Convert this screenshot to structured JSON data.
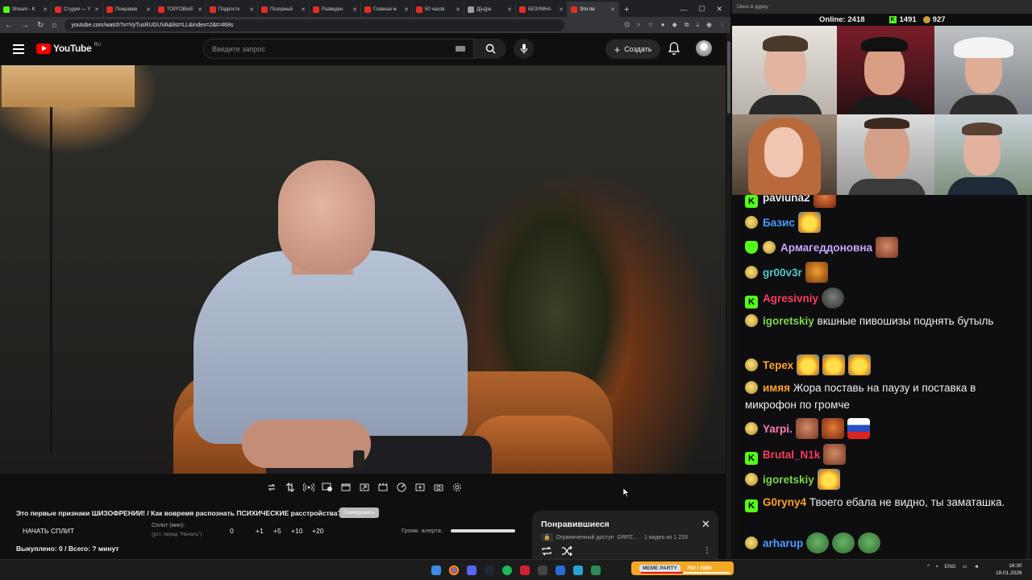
{
  "browser": {
    "tabs": [
      {
        "label": "Stream - K",
        "icon": "kick-icon"
      },
      {
        "label": "Студия — Y",
        "icon": "youtube-icon"
      },
      {
        "label": "Понравив",
        "icon": "youtube-icon"
      },
      {
        "label": "ТОРГОВЫЕ",
        "icon": "youtube-icon"
      },
      {
        "label": "Подростк",
        "icon": "youtube-icon"
      },
      {
        "label": "Позорный",
        "icon": "youtube-icon"
      },
      {
        "label": "Разведен",
        "icon": "youtube-icon"
      },
      {
        "label": "Главная м",
        "icon": "youtube-icon"
      },
      {
        "label": "50 часов",
        "icon": "youtube-icon"
      },
      {
        "label": "Д[ы]ра",
        "icon": "page-icon"
      },
      {
        "label": "БЕЗУМНА",
        "icon": "youtube-icon"
      },
      {
        "label": "Это пе",
        "icon": "youtube-icon"
      }
    ],
    "url": "youtube.com/watch?v=VyTusRUGUVA&list=LL&index=2&t=468s"
  },
  "youtube": {
    "logo_text": "YouTube",
    "region": "RU",
    "search_placeholder": "Введите запрос",
    "create_label": "Создать"
  },
  "video": {
    "title": "Это первые признаки ШИЗОФРЕНИИ! / Как вовремя распознать ПСИХИЧЕСКИЕ расстройства?",
    "title_badge": "Скопировать"
  },
  "split_tracker": {
    "start_label": "НАЧАТЬ СПЛИТ",
    "split_label": "Сплит (мин):",
    "split_hint": "(уст. перед \"Начать\")",
    "buttons": [
      "0",
      "+1",
      "+5",
      "+10",
      "+20"
    ],
    "loudness_label": "Громк. алерта:",
    "loudness_level": 1.0,
    "bought": "Выкуплено: 0 / Всего: ? минут"
  },
  "playlist": {
    "title": "Понравившиеся",
    "access": "Ограниченный доступ",
    "owner": "GRPZ...",
    "position": "· 1 видео из 1 233"
  },
  "stream": {
    "window_title": "Окно в дурку",
    "online_label": "Online:",
    "online_count": "2418",
    "kick_count": "1491",
    "sub_count": "927"
  },
  "chat": {
    "colors": {
      "green": "#53fc18"
    },
    "messages": [
      {
        "user": "paviuna2",
        "badge": "kick",
        "color": "#e8e8e8",
        "text": "",
        "emotes": [
          "crest"
        ]
      },
      {
        "user": "Базис",
        "badge": "gold",
        "color": "#4a9cff",
        "text": "",
        "emotes": [
          "laugh"
        ]
      },
      {
        "user": "Армагеддоновна",
        "badge": "shield+gold",
        "color": "#c8a7ff",
        "text": "",
        "emotes": [
          "face"
        ]
      },
      {
        "user": "gr00v3r",
        "badge": "gold",
        "color": "#4ec7c7",
        "text": "",
        "emotes": [
          "tiger"
        ]
      },
      {
        "user": "Agresivniy",
        "badge": "kick",
        "color": "#ff3860",
        "text": "",
        "emotes": [
          "seal"
        ]
      },
      {
        "user": "igoretskiy",
        "badge": "gold",
        "color": "#7fd34a",
        "text": "вкшные пивошизы поднять бутыль",
        "emotes": []
      },
      {
        "user": "Терех",
        "badge": "gold",
        "color": "#ffa227",
        "text": "",
        "emotes": [
          "laugh",
          "laugh",
          "laugh"
        ]
      },
      {
        "user": "имяя",
        "badge": "gold",
        "color": "#ffa227",
        "text": "Жора поставь на паузу и поставка в микрофон по громче",
        "emotes": []
      },
      {
        "user": "Yarpi.",
        "badge": "gold",
        "color": "#ff7ab6",
        "text": "",
        "emotes": [
          "face",
          "crest",
          "flag"
        ]
      },
      {
        "user": "Brutal_N1k",
        "badge": "kick",
        "color": "#ff3860",
        "text": "",
        "emotes": [
          "face"
        ]
      },
      {
        "user": "igoretskiy",
        "badge": "gold",
        "color": "#7fd34a",
        "text": "",
        "emotes": [
          "laugh"
        ]
      },
      {
        "user": "G0ryny4",
        "badge": "kick",
        "color": "#ffa227",
        "text": "Твоего ебала не видно, ты заматашка.",
        "emotes": []
      },
      {
        "user": "arharup",
        "badge": "gold",
        "color": "#4a9cff",
        "text": "",
        "emotes": [
          "frog",
          "frog",
          "frog"
        ]
      }
    ]
  },
  "taskbar": {
    "meme_party_label": "MEME PARTY",
    "meme_party_counter": "750 / 1590",
    "meme_party_progress": 0.47,
    "lang": "ENG",
    "time": "16:30",
    "date": "18.01.2026"
  }
}
